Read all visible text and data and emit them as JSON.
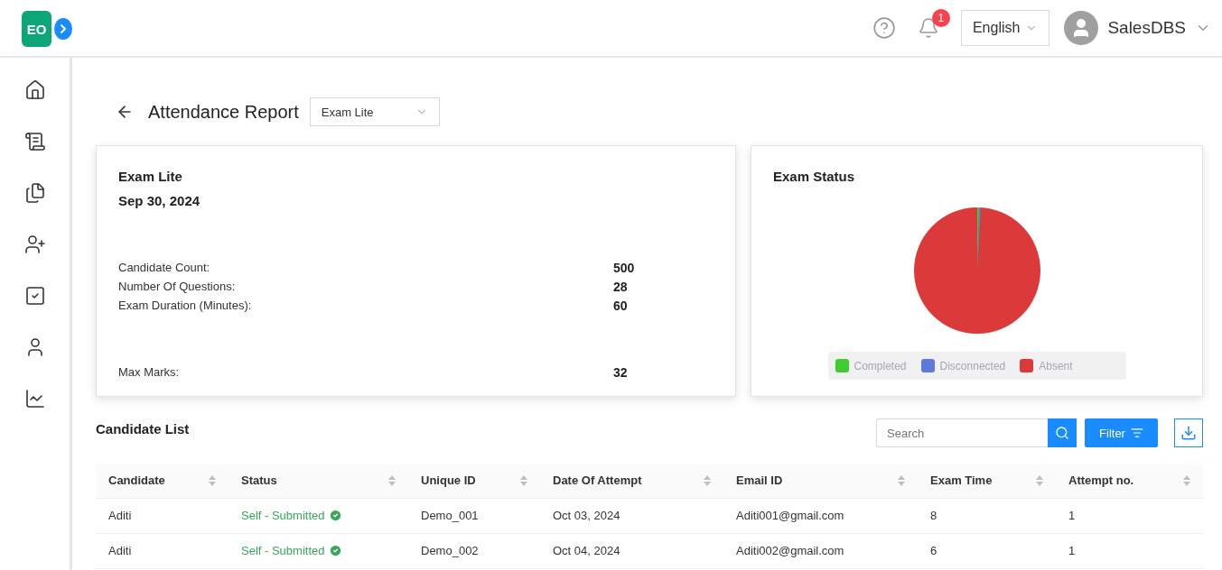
{
  "logo": {
    "text": "EO"
  },
  "header": {
    "notification_count": "1",
    "language": "English",
    "user": "SalesDBS"
  },
  "page": {
    "title": "Attendance Report",
    "exam_select": "Exam Lite"
  },
  "summary": {
    "exam_name": "Exam Lite",
    "date": "Sep 30, 2024",
    "stats": [
      {
        "label": "Candidate Count:",
        "value": "500"
      },
      {
        "label": "Number Of Questions:",
        "value": "28"
      },
      {
        "label": "Exam Duration (Minutes):",
        "value": "60"
      }
    ],
    "max_marks": {
      "label": "Max Marks:",
      "value": "32"
    }
  },
  "exam_status": {
    "title": "Exam Status",
    "legend": [
      {
        "label": "Completed",
        "color": "#3fcc2e"
      },
      {
        "label": "Disconnected",
        "color": "#5f79da"
      },
      {
        "label": "Absent",
        "color": "#dc3a3a"
      }
    ]
  },
  "candidate_list": {
    "title": "Candidate List",
    "search": {
      "placeholder": "Search"
    },
    "filter_button": "Filter",
    "columns": [
      "Candidate",
      "Status",
      "Unique ID",
      "Date Of Attempt",
      "Email ID",
      "Exam Time",
      "Attempt no."
    ],
    "rows": [
      [
        "Aditi",
        "Self - Submitted",
        "Demo_001",
        "Oct 03, 2024",
        "Aditi001@gmail.com",
        "8",
        "1"
      ],
      [
        "Aditi",
        "Self - Submitted",
        "Demo_002",
        "Oct 04, 2024",
        "Aditi002@gmail.com",
        "6",
        "1"
      ]
    ]
  }
}
